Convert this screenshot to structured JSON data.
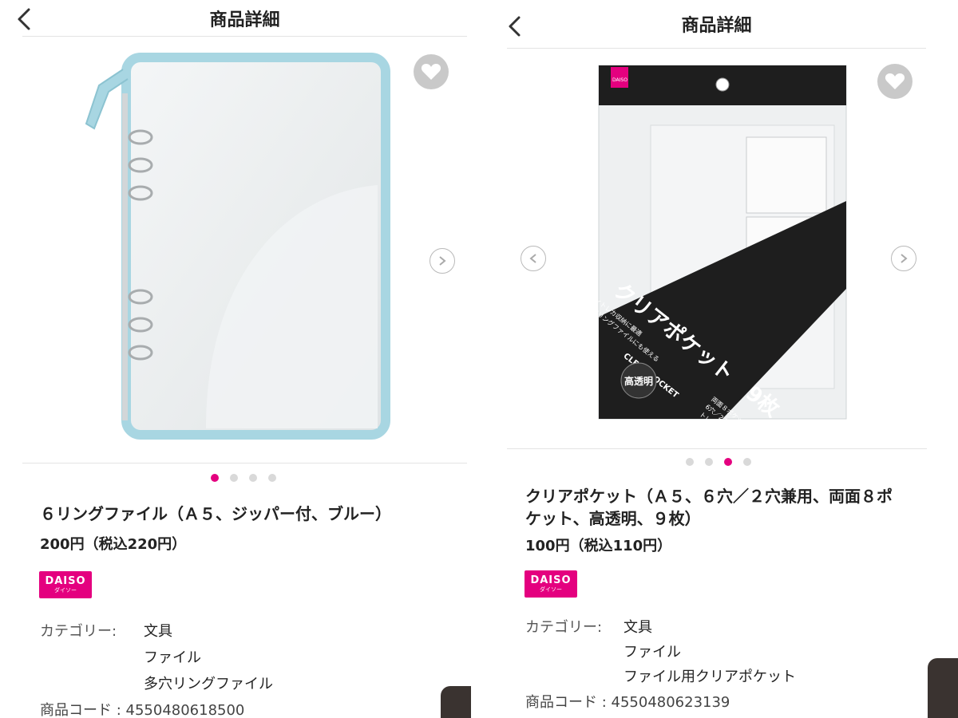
{
  "left": {
    "header_title": "商品詳細",
    "product_title": "６リングファイル（Ａ５、ジッパー付、ブルー）",
    "price": "200円（税込220円）",
    "badge": {
      "brand": "DAISO",
      "sub": "ダイソー"
    },
    "category_label": "カテゴリー:",
    "categories": [
      "文具",
      "ファイル",
      "多穴リングファイル"
    ],
    "product_code": "商品コード : 4550480618500",
    "carousel": {
      "total": 4,
      "active": 1
    }
  },
  "right": {
    "header_title": "商品詳細",
    "product_title_line1": "クリアポケット（Ａ５、６穴／２穴兼用、両面８ポ",
    "product_title_line2": "ケット、高透明、９枚）",
    "price": "100円（税込110円）",
    "badge": {
      "brand": "DAISO",
      "sub": "ダイソー"
    },
    "category_label": "カテゴリー:",
    "categories": [
      "文具",
      "ファイル",
      "ファイル用クリアポケット"
    ],
    "product_code": "商品コード : 4550480623139",
    "carousel": {
      "total": 4,
      "active": 3
    },
    "package": {
      "brand": "DAISO",
      "main_text": "クリアポケット",
      "count_text": "9枚",
      "sub_en": "CLEAR POCKET",
      "high_clear": "高透明",
      "note1": "✓トレカ収納に最適",
      "note2": "✓2リングファイルにも使える",
      "spec1": "両面８ポケット",
      "spec2": "6穴／2穴兼用",
      "spec3": "トレカサイズ"
    }
  },
  "colors": {
    "accent": "#e4007f",
    "binder_edge": "#a8d6e2",
    "package_dark": "#1e1e1e"
  }
}
